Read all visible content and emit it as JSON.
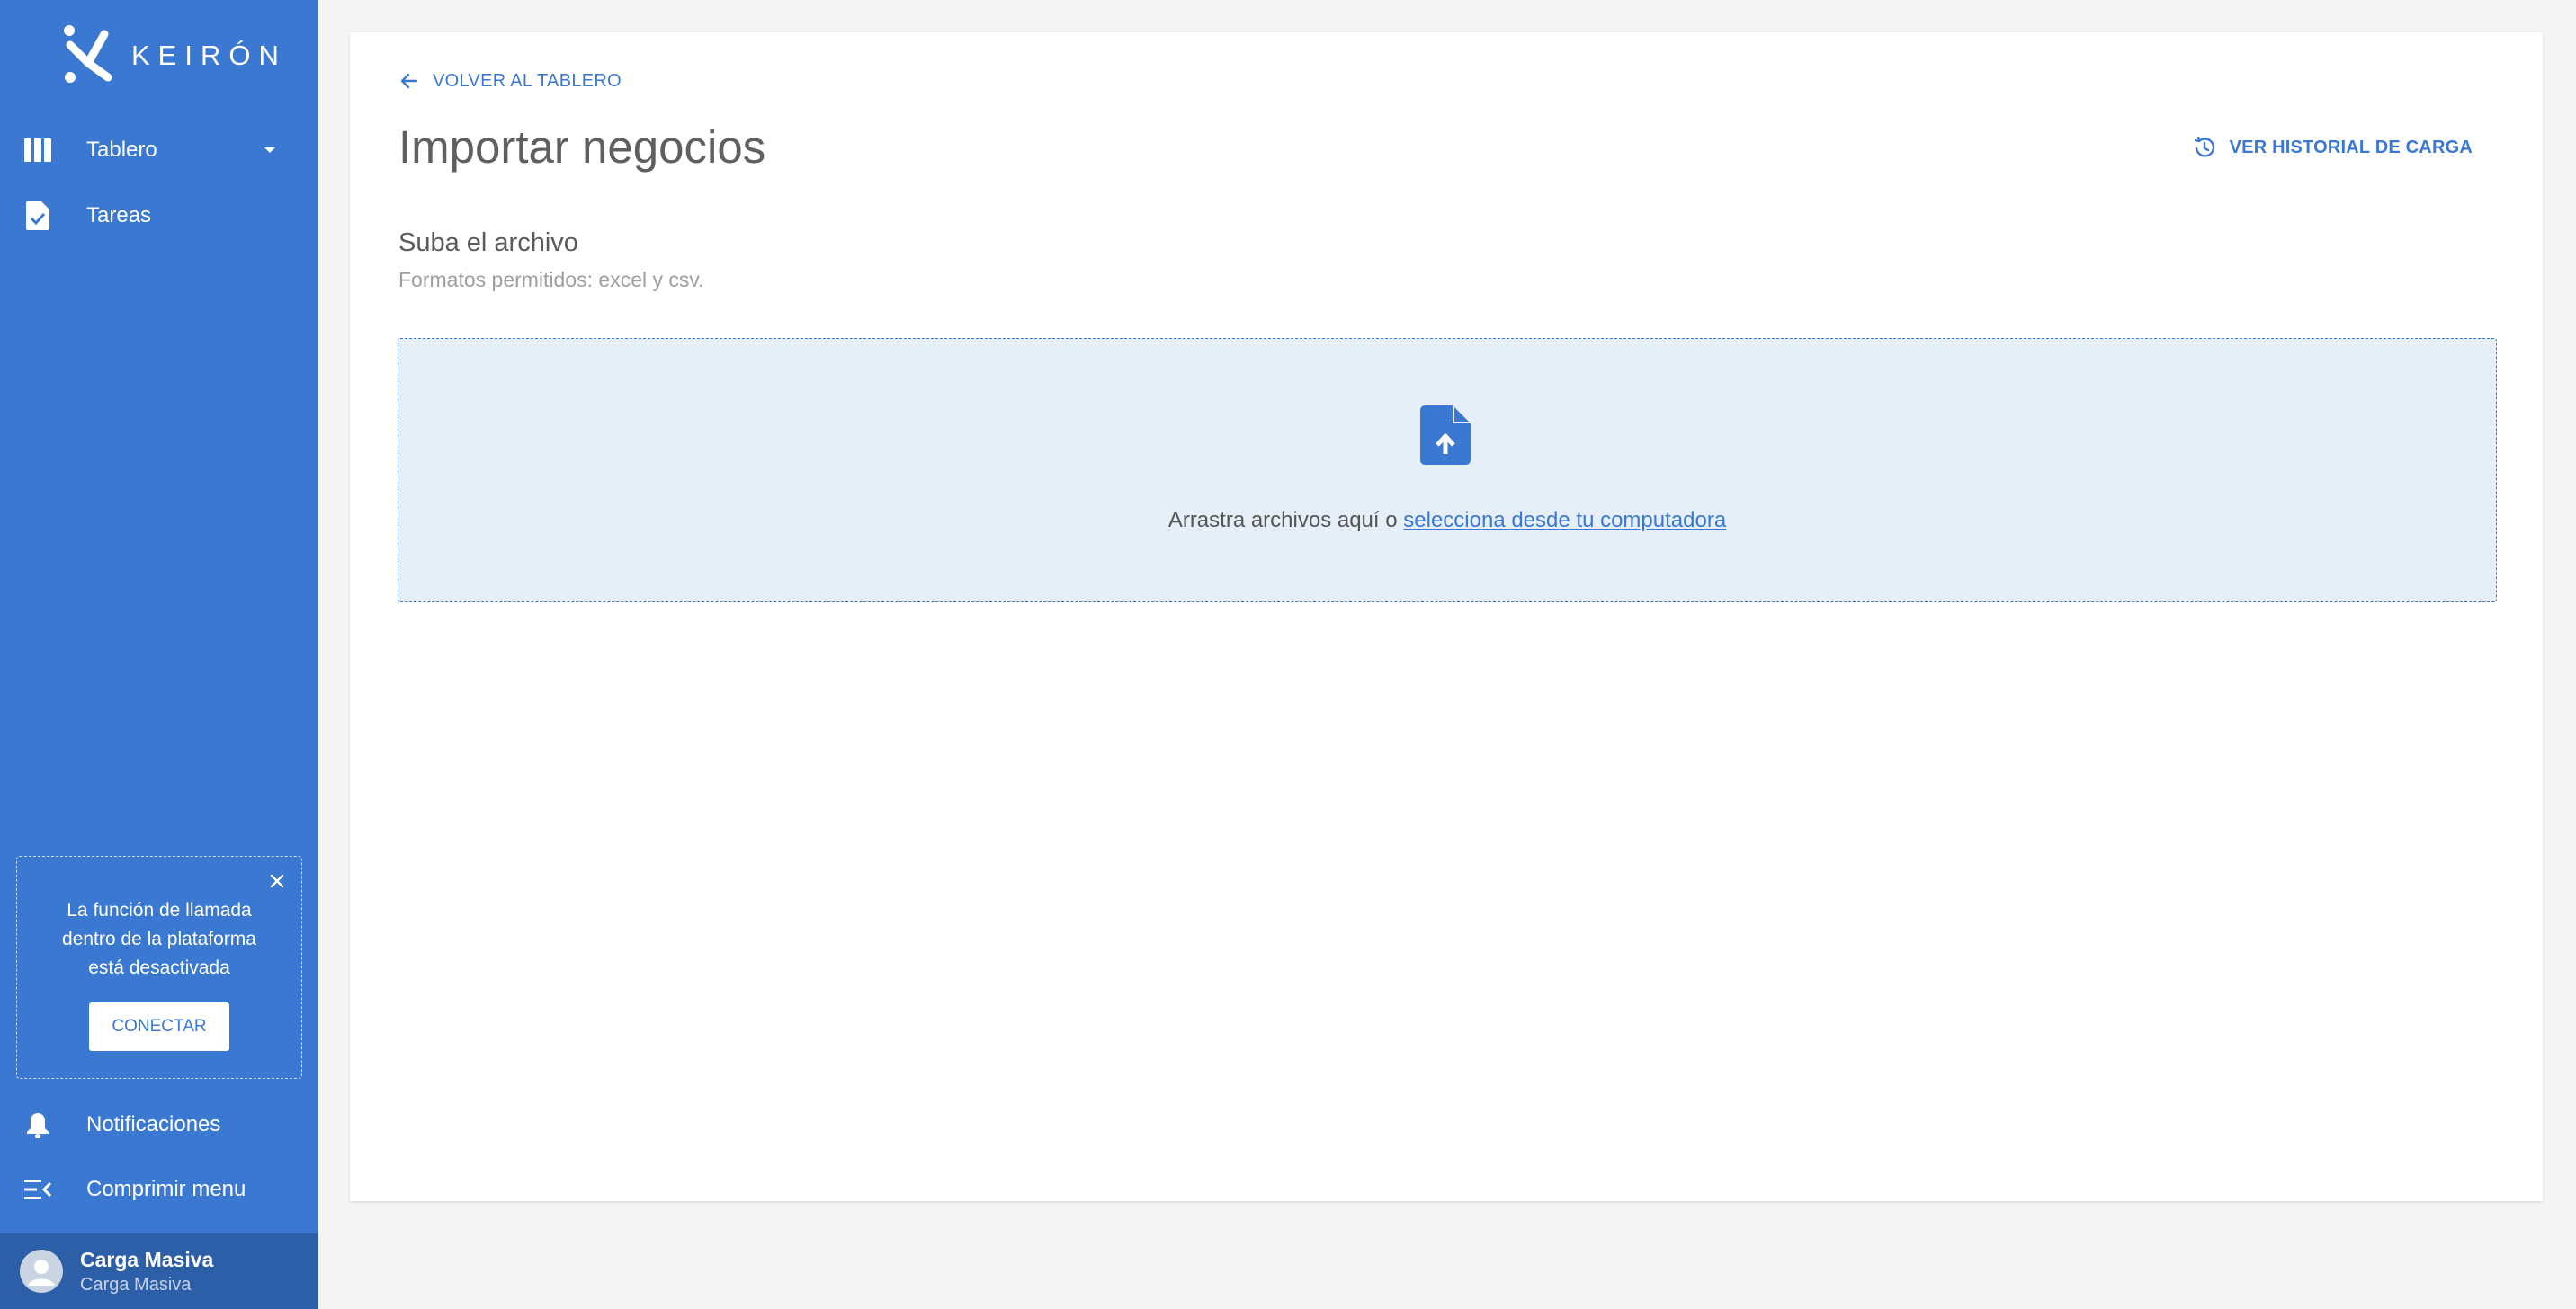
{
  "brand": {
    "name": "KEIRÓN"
  },
  "sidebar": {
    "items": [
      {
        "label": "Tablero",
        "icon": "board-columns-icon"
      },
      {
        "label": "Tareas",
        "icon": "task-file-check-icon"
      }
    ],
    "call_notice": {
      "text": "La función de llamada dentro de la plataforma está desactivada",
      "button_label": "CONECTAR"
    },
    "bottom_items": [
      {
        "label": "Notificaciones",
        "icon": "bell-icon"
      },
      {
        "label": "Comprimir menu",
        "icon": "collapse-menu-icon"
      }
    ],
    "user": {
      "name": "Carga Masiva",
      "role": "Carga Masiva"
    }
  },
  "main": {
    "back_label": "VOLVER AL TABLERO",
    "title": "Importar negocios",
    "history_label": "VER HISTORIAL DE CARGA",
    "upload": {
      "title": "Suba el archivo",
      "subtitle": "Formatos permitidos: excel y csv.",
      "drop_text": "Arrastra archivos aquí o",
      "drop_link": "selecciona desde tu computadora"
    }
  },
  "colors": {
    "sidebar": "#3a78d2",
    "user_bar": "#2d5fa8",
    "accent": "#3a78d2",
    "dropzone_bg": "#e6eef8",
    "page_bg": "#f4f4f4"
  }
}
